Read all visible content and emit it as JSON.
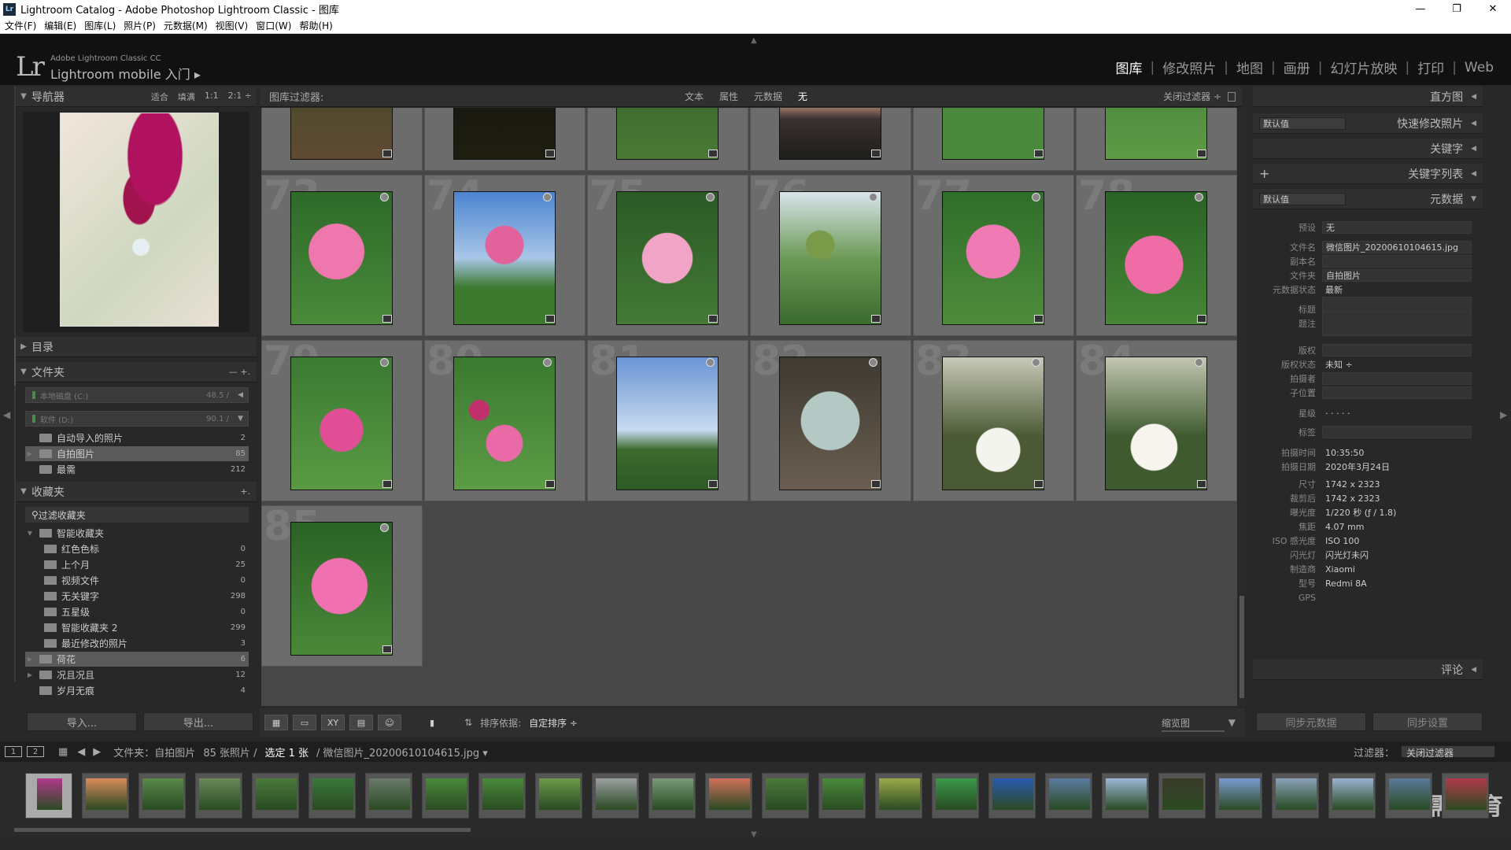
{
  "window": {
    "title": "Lightroom Catalog - Adobe Photoshop Lightroom Classic - 图库",
    "icon": "Lr",
    "min": "—",
    "restore": "❐",
    "close": "✕"
  },
  "menu": [
    "文件(F)",
    "编辑(E)",
    "图库(L)",
    "照片(P)",
    "元数据(M)",
    "视图(V)",
    "窗口(W)",
    "帮助(H)"
  ],
  "brand": {
    "logo": "Lr",
    "sub": "Adobe Lightroom Classic CC",
    "mobile": "Lightroom mobile 入门 ▸"
  },
  "modules": [
    "图库",
    "修改照片",
    "地图",
    "画册",
    "幻灯片放映",
    "打印",
    "Web"
  ],
  "left": {
    "navigator": {
      "title": "导航器",
      "opts": [
        "适合",
        "填满",
        "1:1",
        "2:1 ÷"
      ]
    },
    "catalog": "目录",
    "folders": {
      "title": "文件夹",
      "actions": "—  +.",
      "volumes": [
        {
          "name": "本地磁盘 (C:)",
          "size": "48.5 /"
        },
        {
          "name": "软件 (D:)",
          "size": "90.1 /"
        }
      ],
      "items": [
        {
          "name": "自动导入的照片",
          "count": "2"
        },
        {
          "name": "自拍图片",
          "count": "85"
        },
        {
          "name": "最需",
          "count": "212"
        }
      ]
    },
    "collections": {
      "title": "收藏夹",
      "add": "+.",
      "filter": "过滤收藏夹",
      "smart": "智能收藏夹",
      "smart_items": [
        {
          "name": "红色色标",
          "count": "0"
        },
        {
          "name": "上个月",
          "count": "25"
        },
        {
          "name": "视频文件",
          "count": "0"
        },
        {
          "name": "无关键字",
          "count": "298"
        },
        {
          "name": "五星级",
          "count": "0"
        },
        {
          "name": "智能收藏夹 2",
          "count": "299"
        },
        {
          "name": "最近修改的照片",
          "count": "3"
        }
      ],
      "others": [
        {
          "name": "荷花",
          "count": "6"
        },
        {
          "name": "况且况且",
          "count": "12"
        },
        {
          "name": "岁月无痕",
          "count": "4"
        }
      ]
    },
    "import_btn": "导入...",
    "export_btn": "导出..."
  },
  "filterbar": {
    "label": "图库过滤器:",
    "tabs": [
      "文本",
      "属性",
      "元数据",
      "无"
    ],
    "close": "关闭过滤器 ÷"
  },
  "grid": {
    "numbers": [
      "",
      "",
      "",
      "",
      "",
      "",
      "73",
      "74",
      "75",
      "76",
      "77",
      "78",
      "79",
      "80",
      "81",
      "82",
      "83",
      "84",
      "85"
    ]
  },
  "toolbar": {
    "sort_label": "排序依据:",
    "sort_value": "自定排序 ÷",
    "thumb_label": "缩览图"
  },
  "right": {
    "histogram": "直方图",
    "quick": "快速修改照片",
    "quick_preset": "默认值",
    "keyword": "关键字",
    "keyword_list": "关键字列表",
    "add": "+",
    "metadata": "元数据",
    "meta_preset": "默认值",
    "fields": [
      {
        "k": "预设",
        "v": "无"
      },
      {
        "k": "文件名",
        "v": "微信图片_20200610104615.jpg"
      },
      {
        "k": "副本名",
        "v": ""
      },
      {
        "k": "文件夹",
        "v": "自拍图片"
      },
      {
        "k": "元数据状态",
        "v": "最新"
      },
      {
        "k": "标题",
        "v": ""
      },
      {
        "k": "题注",
        "v": ""
      },
      {
        "k": "版权",
        "v": ""
      },
      {
        "k": "版权状态",
        "v": "未知 ÷"
      },
      {
        "k": "拍摄者",
        "v": ""
      },
      {
        "k": "子位置",
        "v": ""
      },
      {
        "k": "星级",
        "v": "· · · · ·"
      },
      {
        "k": "标签",
        "v": ""
      },
      {
        "k": "拍摄时间",
        "v": "10:35:50"
      },
      {
        "k": "拍摄日期",
        "v": "2020年3月24日"
      },
      {
        "k": "尺寸",
        "v": "1742 x 2323"
      },
      {
        "k": "裁剪后",
        "v": "1742 x 2323"
      },
      {
        "k": "曝光度",
        "v": "1/220 秒 (ƒ / 1.8)"
      },
      {
        "k": "焦距",
        "v": "4.07 mm"
      },
      {
        "k": "ISO 感光度",
        "v": "ISO 100"
      },
      {
        "k": "闪光灯",
        "v": "闪光灯未闪"
      },
      {
        "k": "制造商",
        "v": "Xiaomi"
      },
      {
        "k": "型号",
        "v": "Redmi 8A"
      },
      {
        "k": "GPS",
        "v": ""
      }
    ],
    "comments": "评论",
    "sync_meta": "同步元数据",
    "sync_settings": "同步设置"
  },
  "filmstrip": {
    "mon1": "1",
    "mon2": "2",
    "path": "文件夹：自拍图片",
    "count": "85 张照片 /",
    "selected": "选定 1 张",
    "file": "/ 微信图片_20200610104615.jpg ▾",
    "filter_label": "过滤器：",
    "filter_value": "关闭过滤器"
  },
  "watermark": "最需教育"
}
